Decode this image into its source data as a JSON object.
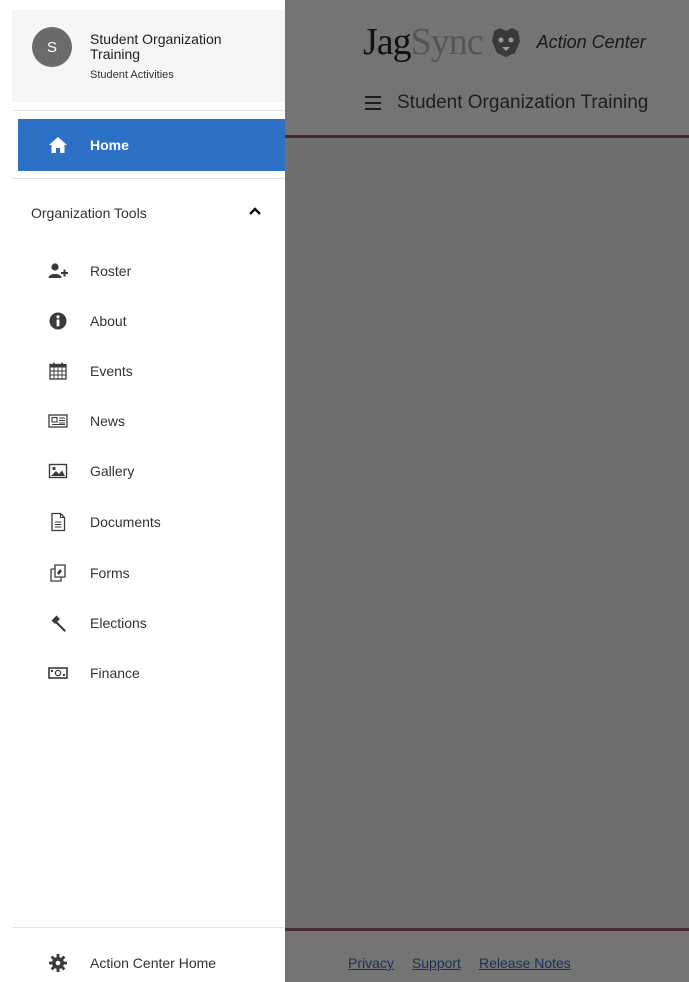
{
  "drawer": {
    "avatar_letter": "S",
    "org_name": "Student Organization Training",
    "org_category": "Student Activities",
    "home_label": "Home",
    "section_label": "Organization Tools",
    "items": [
      {
        "label": "Roster",
        "icon": "add-user-icon"
      },
      {
        "label": "About",
        "icon": "info-icon"
      },
      {
        "label": "Events",
        "icon": "calendar-icon"
      },
      {
        "label": "News",
        "icon": "newspaper-icon"
      },
      {
        "label": "Gallery",
        "icon": "image-icon"
      },
      {
        "label": "Documents",
        "icon": "document-icon"
      },
      {
        "label": "Forms",
        "icon": "forms-icon"
      },
      {
        "label": "Elections",
        "icon": "gavel-icon"
      },
      {
        "label": "Finance",
        "icon": "money-icon"
      }
    ],
    "bottom_label": "Action Center Home"
  },
  "header": {
    "brand_jag": "Jag",
    "brand_sync": "Sync",
    "brand_suffix": "Action Center",
    "org_title": "Student Organization Training"
  },
  "footer": {
    "privacy": "Privacy",
    "support": "Support",
    "release_notes": "Release Notes"
  },
  "colors": {
    "accent": "#2c71c6",
    "overlay": "#6f6f6f",
    "rule": "#4a2a30"
  }
}
